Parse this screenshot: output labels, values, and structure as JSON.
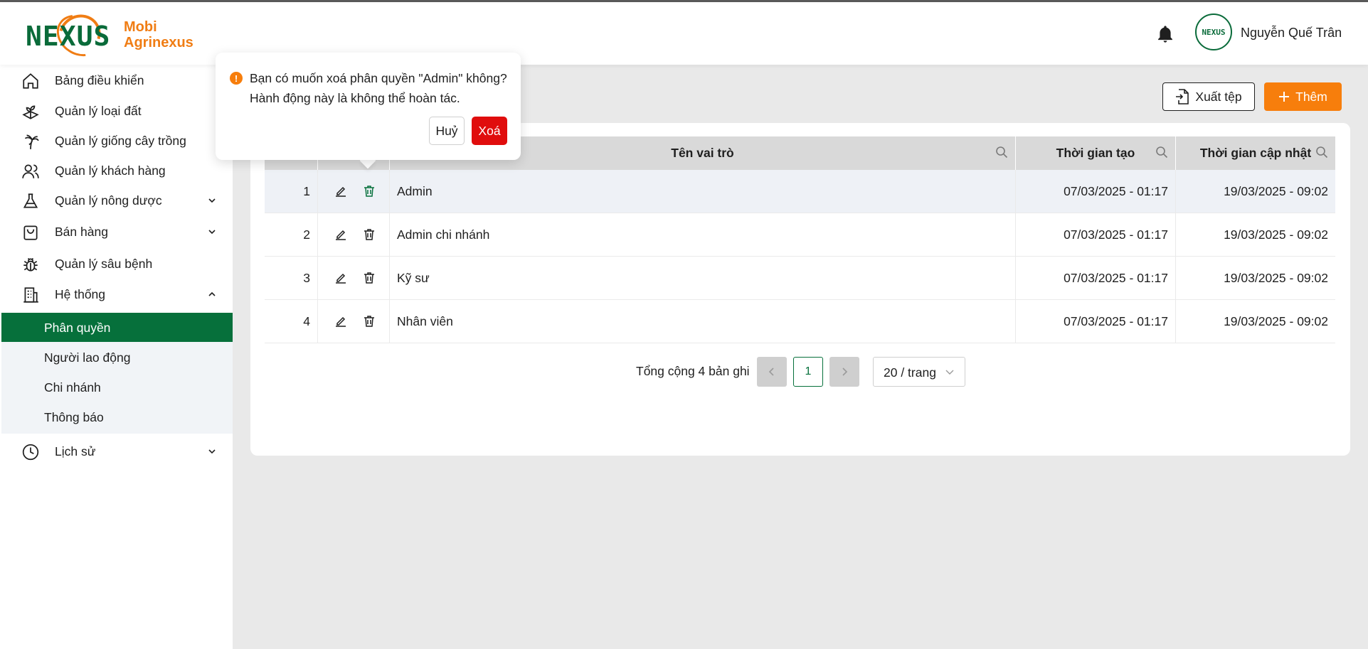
{
  "header": {
    "brand_line1": "Mobi",
    "brand_line2": "Agrinexus",
    "logo_text": "NEXUS",
    "user_name": "Nguyễn Quế Trân",
    "avatar_text": "NEXUS"
  },
  "sidebar": {
    "items": [
      {
        "label": "Bảng điều khiển",
        "icon": "home-icon"
      },
      {
        "label": "Quản lý loại đất",
        "icon": "soil-icon"
      },
      {
        "label": "Quản lý giống cây trồng",
        "icon": "palm-tree-icon"
      },
      {
        "label": "Quản lý khách hàng",
        "icon": "users-icon"
      },
      {
        "label": "Quản lý nông dược",
        "icon": "flask-icon"
      },
      {
        "label": "Bán hàng",
        "icon": "shopping-bag-icon"
      },
      {
        "label": "Quản lý sâu bệnh",
        "icon": "bug-icon"
      },
      {
        "label": "Hệ thống",
        "icon": "building-icon"
      },
      {
        "label": "Lịch sử",
        "icon": "clock-icon"
      }
    ],
    "submenu": [
      {
        "label": "Phân quyền",
        "active": true
      },
      {
        "label": "Người lao động",
        "active": false
      },
      {
        "label": "Chi nhánh",
        "active": false
      },
      {
        "label": "Thông báo",
        "active": false
      }
    ]
  },
  "toolbar": {
    "export_label": "Xuất tệp",
    "add_label": "Thêm"
  },
  "table": {
    "columns": [
      "Tên vai trò",
      "Thời gian tạo",
      "Thời gian cập nhật"
    ],
    "rows": [
      {
        "index": "1",
        "name": "Admin",
        "created": "07/03/2025 - 01:17",
        "updated": "19/03/2025 - 09:02"
      },
      {
        "index": "2",
        "name": "Admin chi nhánh",
        "created": "07/03/2025 - 01:17",
        "updated": "19/03/2025 - 09:02"
      },
      {
        "index": "3",
        "name": "Kỹ sư",
        "created": "07/03/2025 - 01:17",
        "updated": "19/03/2025 - 09:02"
      },
      {
        "index": "4",
        "name": "Nhân viên",
        "created": "07/03/2025 - 01:17",
        "updated": "19/03/2025 - 09:02"
      }
    ]
  },
  "pagination": {
    "total_label": "Tổng cộng 4 bản ghi",
    "current_page": "1",
    "page_size": "20 / trang"
  },
  "popconfirm": {
    "line1": "Bạn có muốn xoá phân quyền \"Admin\" không?",
    "line2": "Hành động này là không thể hoàn tác.",
    "cancel_label": "Huỷ",
    "ok_label": "Xoá",
    "icon_glyph": "!"
  },
  "colors": {
    "brand_green": "#06703b",
    "brand_orange": "#f77e0c",
    "danger_red": "#e00d0d",
    "content_bg": "#e9e9e9"
  }
}
